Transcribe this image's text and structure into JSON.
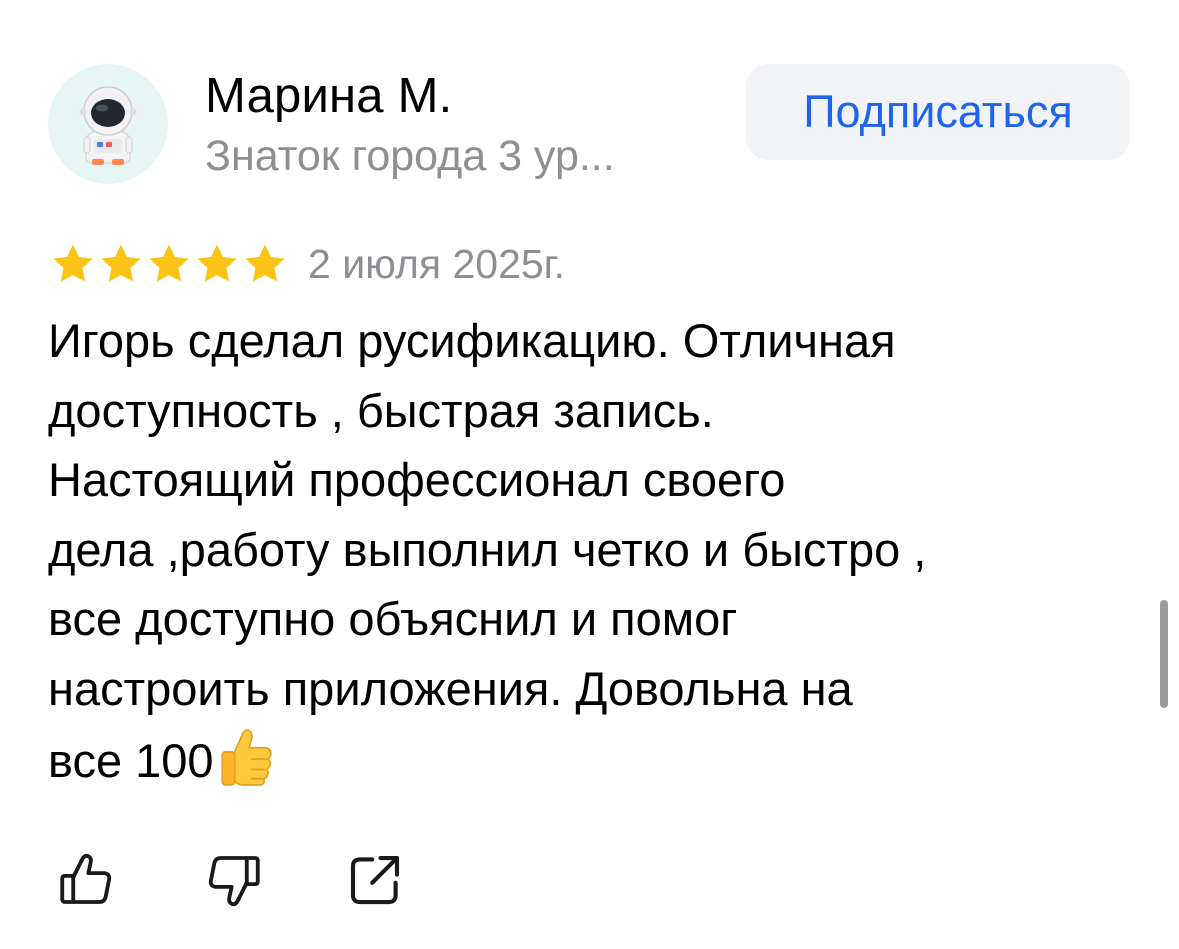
{
  "author": {
    "name": "Марина М.",
    "level": "Знаток города 3 ур...",
    "avatar_icon": "astronaut-icon"
  },
  "subscribe": {
    "label": "Подписаться"
  },
  "review": {
    "rating": 5,
    "rating_max": 5,
    "date": "2 июля 2025г.",
    "text_lines": [
      "Игорь сделал русификацию. Отличная",
      "доступность , быстрая запись.",
      "Настоящий профессионал своего",
      "дела ,работу выполнил четко и быстро ,",
      "все доступно объяснил и помог",
      "настроить приложения. Довольна на",
      "все 100"
    ],
    "trailing_emoji": "thumbs-up-emoji"
  },
  "actions": {
    "like_icon": "thumbs-up-icon",
    "dislike_icon": "thumbs-down-icon",
    "share_icon": "share-icon"
  },
  "colors": {
    "accent": "#1e64f0",
    "button_bg": "#f1f3f7",
    "secondary_text": "#8e8e93",
    "star": "#fcc419",
    "avatar_bg": "#e6f6f5"
  }
}
